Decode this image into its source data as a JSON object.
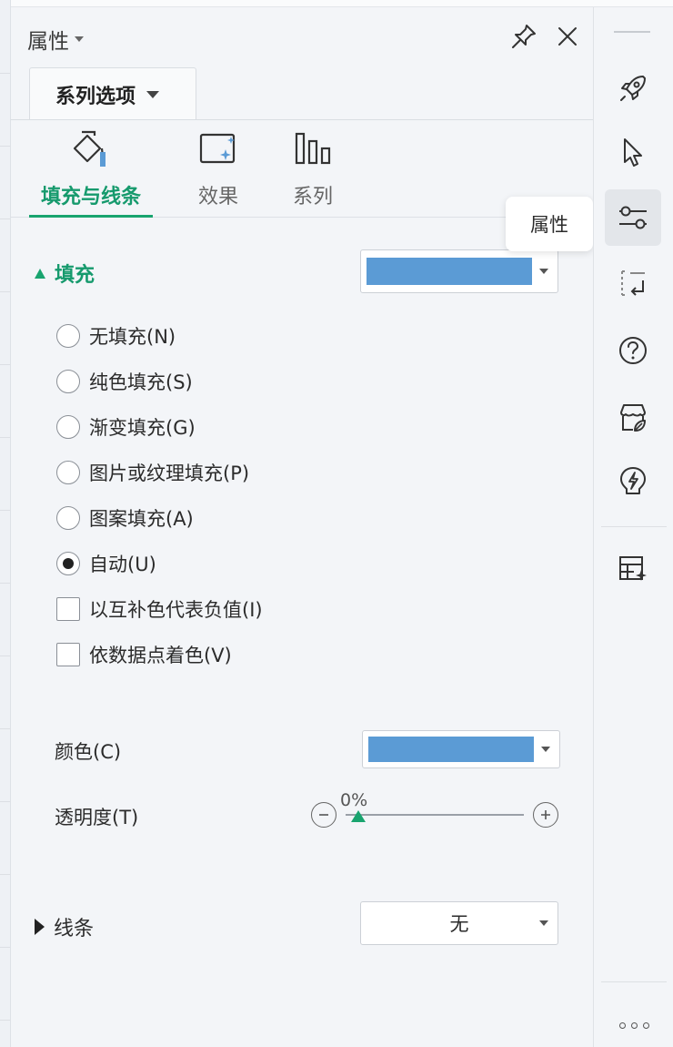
{
  "panel": {
    "title": "属性",
    "series_tab_label": "系列选项"
  },
  "subtabs": [
    {
      "label": "填充与线条",
      "icon": "fill-bucket-icon",
      "active": true
    },
    {
      "label": "效果",
      "icon": "effects-icon",
      "active": false
    },
    {
      "label": "系列",
      "icon": "series-bars-icon",
      "active": false
    }
  ],
  "fill": {
    "heading": "填充",
    "dropdown_color": "#5b9bd5",
    "options": [
      {
        "label": "无填充(N)",
        "type": "radio",
        "checked": false
      },
      {
        "label": "纯色填充(S)",
        "type": "radio",
        "checked": false
      },
      {
        "label": "渐变填充(G)",
        "type": "radio",
        "checked": false
      },
      {
        "label": "图片或纹理填充(P)",
        "type": "radio",
        "checked": false
      },
      {
        "label": "图案填充(A)",
        "type": "radio",
        "checked": false
      },
      {
        "label": "自动(U)",
        "type": "radio",
        "checked": true
      },
      {
        "label": "以互补色代表负值(I)",
        "type": "checkbox",
        "checked": false
      },
      {
        "label": "依数据点着色(V)",
        "type": "checkbox",
        "checked": false
      }
    ],
    "color_label": "颜色(C)",
    "color_value": "#5b9bd5",
    "transparency_label": "透明度(T)",
    "transparency_value": "0%",
    "transparency_fraction": 0
  },
  "line": {
    "heading": "线条",
    "value": "无"
  },
  "tooltip": "属性",
  "colors": {
    "accent": "#19a46f",
    "swatch": "#5b9bd5"
  }
}
